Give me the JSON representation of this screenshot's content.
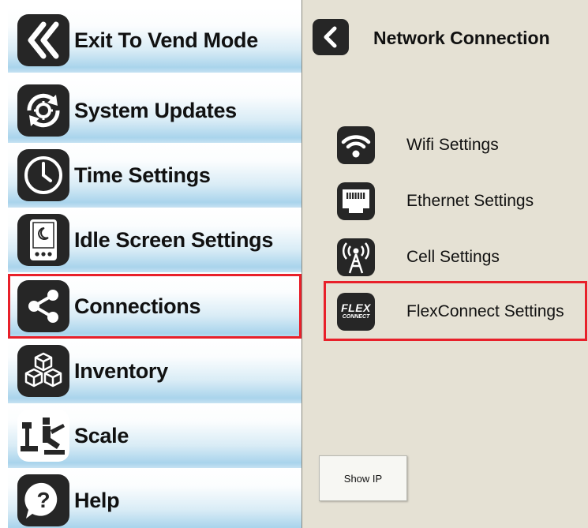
{
  "menu": {
    "items": [
      {
        "label": "Exit To Vend Mode",
        "icon": "double-chevron-left-icon"
      },
      {
        "label": "System Updates",
        "icon": "refresh-gear-icon"
      },
      {
        "label": "Time Settings",
        "icon": "clock-icon"
      },
      {
        "label": "Idle Screen Settings",
        "icon": "idle-device-icon"
      },
      {
        "label": "Connections",
        "icon": "share-icon",
        "selected": true
      },
      {
        "label": "Inventory",
        "icon": "boxes-icon"
      },
      {
        "label": "Scale",
        "icon": "scale-icon"
      },
      {
        "label": "Help",
        "icon": "question-icon"
      }
    ]
  },
  "panel": {
    "title": "Network Connection",
    "items": [
      {
        "label": "Wifi Settings",
        "icon": "wifi-icon"
      },
      {
        "label": "Ethernet Settings",
        "icon": "ethernet-icon"
      },
      {
        "label": "Cell Settings",
        "icon": "cell-tower-icon"
      },
      {
        "label": "FlexConnect Settings",
        "icon": "flexconnect-icon",
        "icon_text": [
          "FLEX",
          "CONNECT"
        ],
        "highlighted": true
      }
    ],
    "show_ip_label": "Show IP"
  },
  "colors": {
    "highlight": "#e8202a",
    "panel_bg": "#e5e1d4",
    "icon_bg": "#262626"
  }
}
